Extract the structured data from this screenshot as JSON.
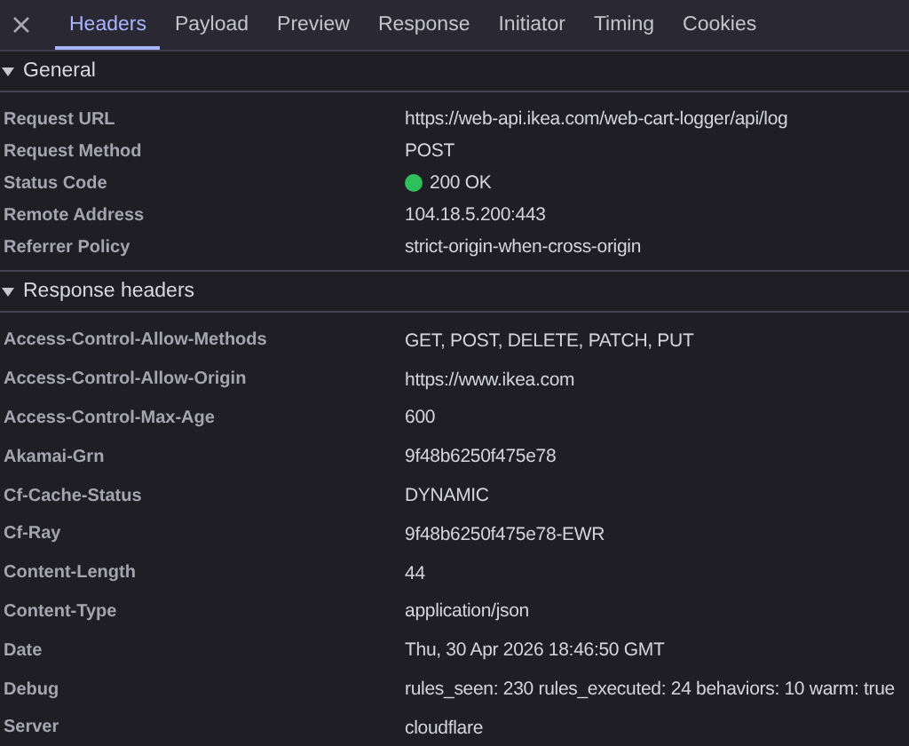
{
  "tabs": [
    {
      "label": "Headers",
      "selected": true
    },
    {
      "label": "Payload",
      "selected": false
    },
    {
      "label": "Preview",
      "selected": false
    },
    {
      "label": "Response",
      "selected": false
    },
    {
      "label": "Initiator",
      "selected": false
    },
    {
      "label": "Timing",
      "selected": false
    },
    {
      "label": "Cookies",
      "selected": false
    }
  ],
  "sections": [
    {
      "title": "General",
      "expanded": true,
      "rows": [
        {
          "name": "Request URL",
          "value": "https://web-api.ikea.com/web-cart-logger/api/log"
        },
        {
          "name": "Request Method",
          "value": "POST"
        },
        {
          "name": "Status Code",
          "value": "200 OK",
          "color": "#2fbf5b"
        },
        {
          "name": "Remote Address",
          "value": "104.18.5.200:443"
        },
        {
          "name": "Referrer Policy",
          "value": "strict-origin-when-cross-origin"
        }
      ]
    },
    {
      "title": "Response headers",
      "expanded": true,
      "rows": [
        {
          "name": "Access-Control-Allow-Methods",
          "value": "GET, POST, DELETE, PATCH, PUT"
        },
        {
          "name": "Access-Control-Allow-Origin",
          "value": "https://www.ikea.com"
        },
        {
          "name": "Access-Control-Max-Age",
          "value": "600"
        },
        {
          "name": "Akamai-Grn",
          "value": "9f48b6250f475e78"
        },
        {
          "name": "Cf-Cache-Status",
          "value": "DYNAMIC"
        },
        {
          "name": "Cf-Ray",
          "value": "9f48b6250f475e78-EWR"
        },
        {
          "name": "Content-Length",
          "value": "44"
        },
        {
          "name": "Content-Type",
          "value": "application/json"
        },
        {
          "name": "Date",
          "value": "Thu, 30 Apr 2026 18:46:50 GMT"
        },
        {
          "name": "Debug",
          "value": "rules_seen: 230 rules_executed: 24 behaviors: 10 warm: true"
        },
        {
          "name": "Server",
          "value": "cloudflare"
        }
      ]
    }
  ]
}
